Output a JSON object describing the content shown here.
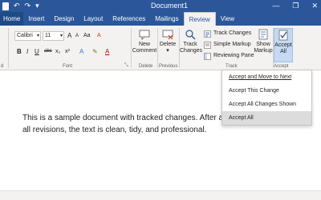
{
  "titlebar": {
    "title": "Document1",
    "undo_glyph": "↶",
    "redo_glyph": "↷",
    "dropdown_glyph": "▾",
    "minimize_glyph": "—",
    "restore_glyph": "❐",
    "close_glyph": "✕",
    "bg_color": "#2b579a"
  },
  "tabs": [
    "Home",
    "Insert",
    "Design",
    "Layout",
    "References",
    "Mailings",
    "Review",
    "View"
  ],
  "active_tab": "Review",
  "font_group": {
    "font_name": "Calibri",
    "font_size": "11",
    "grow_label": "A",
    "shrink_label": "A",
    "case_label": "Aa",
    "clear_label": "A",
    "bold": "B",
    "italic": "I",
    "underline": "U",
    "strike": "abc",
    "subscript": "x₂",
    "superscript": "x²",
    "text_effects": "A",
    "highlight": "✎",
    "font_color": "A",
    "label": "Font",
    "launcher": "⤡",
    "left_clip_label": "d"
  },
  "comments_group": {
    "new_comment_line1": "New",
    "new_comment_line2": "Comment",
    "delete_label": "Delete",
    "delete_group_label": "Delete"
  },
  "previous_group": {
    "label": "Previous"
  },
  "track_group": {
    "track_changes_big_line1": "Track",
    "track_changes_big_line2": "Changes",
    "track_changes": "Track Changes",
    "simple_markup": "Simple Markup",
    "reviewing_pane": "Reviewing Pane",
    "show_markup_line1": "Show",
    "show_markup_line2": "Markup",
    "label": "Track"
  },
  "accept_group": {
    "accept_line1": "Accept",
    "accept_line2": "All",
    "label": "Accept"
  },
  "menu": {
    "items": [
      "Accept and Move to Next",
      "Accept This Change",
      "Accept All Changes Shown",
      "Accept All"
    ],
    "highlighted_index": 3
  },
  "document": {
    "body": "This is a sample document with tracked changes. After accepting all revisions, the text is clean, tidy, and professional."
  },
  "colors": {
    "accent": "#2b579a",
    "menu_highlight": "#dcdcdc",
    "ribbon_bg": "#f3f2f1"
  }
}
